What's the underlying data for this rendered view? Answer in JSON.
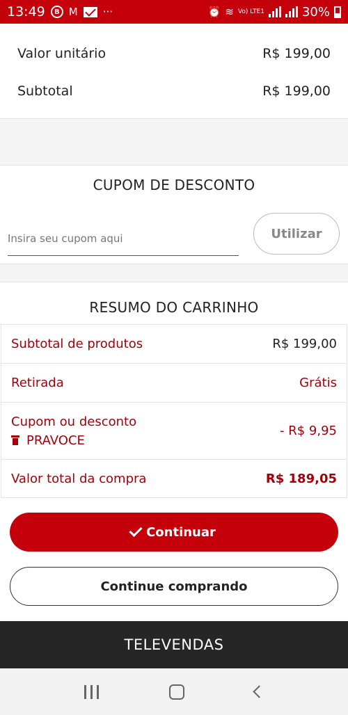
{
  "status_bar": {
    "time": "13:49",
    "battery": "30%",
    "net_label": "Vo) LTE1"
  },
  "item": {
    "unit_label": "Valor unitário",
    "unit_value": "R$ 199,00",
    "subtotal_label": "Subtotal",
    "subtotal_value": "R$ 199,00"
  },
  "coupon": {
    "title": "CUPOM DE DESCONTO",
    "placeholder": "Insira seu cupom aqui",
    "apply_label": "Utilizar"
  },
  "summary": {
    "title": "RESUMO DO CARRINHO",
    "products_label": "Subtotal de produtos",
    "products_value": "R$ 199,00",
    "pickup_label": "Retirada",
    "pickup_value": "Grátis",
    "discount_label": "Cupom ou desconto",
    "coupon_code": "PRAVOCE",
    "discount_value": "- R$ 9,95",
    "total_label": "Valor total da compra",
    "total_value": "R$ 189,05"
  },
  "actions": {
    "continue_label": "Continuar",
    "keep_shopping_label": "Continue comprando"
  },
  "footer": {
    "televendas_label": "TELEVENDAS"
  },
  "colors": {
    "brand_red": "#c4000a",
    "text_red": "#a4000a",
    "footer_dark": "#262626"
  }
}
